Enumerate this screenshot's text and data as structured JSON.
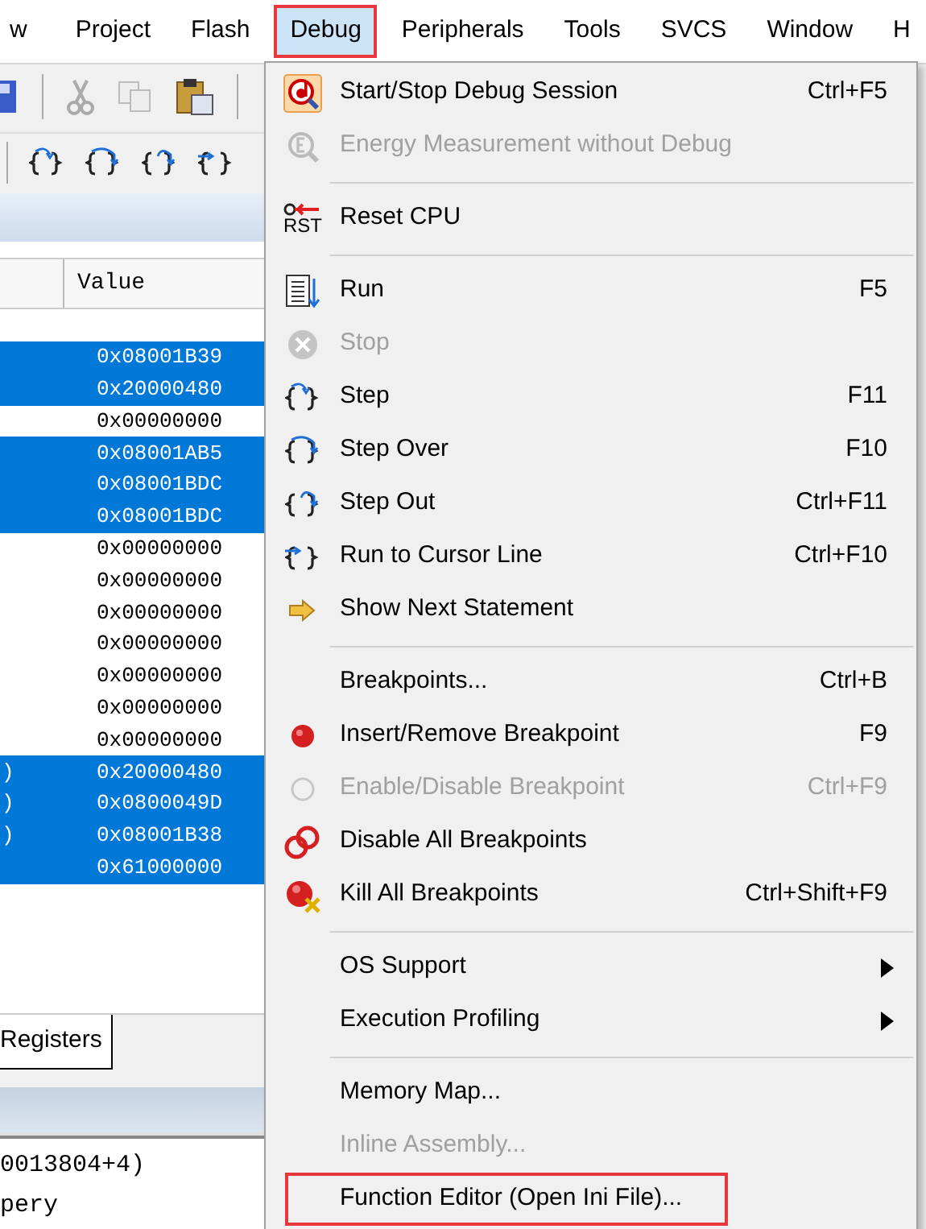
{
  "menubar": [
    {
      "label": "w",
      "selected": false
    },
    {
      "label": "Project",
      "selected": false
    },
    {
      "label": "Flash",
      "selected": false
    },
    {
      "label": "Debug",
      "selected": true
    },
    {
      "label": "Peripherals",
      "selected": false
    },
    {
      "label": "Tools",
      "selected": false
    },
    {
      "label": "SVCS",
      "selected": false
    },
    {
      "label": "Window",
      "selected": false
    },
    {
      "label": "H",
      "selected": false
    }
  ],
  "watch": {
    "columns": [
      "Value"
    ],
    "rows": [
      {
        "value": "0x08001B39",
        "selected": true
      },
      {
        "value": "0x20000480",
        "selected": true
      },
      {
        "value": "0x00000000",
        "selected": false
      },
      {
        "value": "0x08001AB5",
        "selected": true
      },
      {
        "value": "0x08001BDC",
        "selected": true
      },
      {
        "value": "0x08001BDC",
        "selected": true
      },
      {
        "value": "0x00000000",
        "selected": false
      },
      {
        "value": "0x00000000",
        "selected": false
      },
      {
        "value": "0x00000000",
        "selected": false
      },
      {
        "value": "0x00000000",
        "selected": false
      },
      {
        "value": "0x00000000",
        "selected": false
      },
      {
        "value": "0x00000000",
        "selected": false
      },
      {
        "value": "0x00000000",
        "selected": false
      },
      {
        "name": ")",
        "value": "0x20000480",
        "selected": true
      },
      {
        "name": ")",
        "value": "0x0800049D",
        "selected": true
      },
      {
        "name": ")",
        "value": "0x08001B38",
        "selected": true
      },
      {
        "value": "0x61000000",
        "selected": true
      }
    ]
  },
  "tabs": [
    {
      "label": "Registers",
      "selected": true
    }
  ],
  "output_lines": [
    "0013804+4)",
    "pery"
  ],
  "debug_menu": [
    {
      "kind": "item",
      "label": "Start/Stop Debug Session",
      "shortcut": "Ctrl+F5",
      "disabled": false
    },
    {
      "kind": "item",
      "label": "Energy Measurement without Debug",
      "disabled": true
    },
    {
      "kind": "separator"
    },
    {
      "kind": "item",
      "label": "Reset CPU",
      "icon_text": "RST",
      "disabled": false
    },
    {
      "kind": "separator"
    },
    {
      "kind": "item",
      "label": "Run",
      "shortcut": "F5",
      "disabled": false
    },
    {
      "kind": "item",
      "label": "Stop",
      "disabled": true
    },
    {
      "kind": "item",
      "label": "Step",
      "shortcut": "F11",
      "disabled": false
    },
    {
      "kind": "item",
      "label": "Step Over",
      "shortcut": "F10",
      "disabled": false
    },
    {
      "kind": "item",
      "label": "Step Out",
      "shortcut": "Ctrl+F11",
      "disabled": false
    },
    {
      "kind": "item",
      "label": "Run to Cursor Line",
      "shortcut": "Ctrl+F10",
      "disabled": false
    },
    {
      "kind": "item",
      "label": "Show Next Statement",
      "disabled": false
    },
    {
      "kind": "separator"
    },
    {
      "kind": "item",
      "label": "Breakpoints...",
      "shortcut": "Ctrl+B",
      "disabled": false
    },
    {
      "kind": "item",
      "label": "Insert/Remove Breakpoint",
      "shortcut": "F9",
      "disabled": false
    },
    {
      "kind": "item",
      "label": "Enable/Disable Breakpoint",
      "shortcut": "Ctrl+F9",
      "disabled": true
    },
    {
      "kind": "item",
      "label": "Disable All Breakpoints",
      "disabled": false
    },
    {
      "kind": "item",
      "label": "Kill All Breakpoints",
      "shortcut": "Ctrl+Shift+F9",
      "disabled": false
    },
    {
      "kind": "separator"
    },
    {
      "kind": "item",
      "label": "OS Support",
      "submenu": true,
      "disabled": false
    },
    {
      "kind": "item",
      "label": "Execution Profiling",
      "submenu": true,
      "disabled": false
    },
    {
      "kind": "separator"
    },
    {
      "kind": "item",
      "label": "Memory Map...",
      "disabled": false
    },
    {
      "kind": "item",
      "label": "Inline Assembly...",
      "disabled": true
    },
    {
      "kind": "item",
      "label": "Function Editor (Open Ini File)...",
      "disabled": false,
      "outlined": true
    }
  ]
}
